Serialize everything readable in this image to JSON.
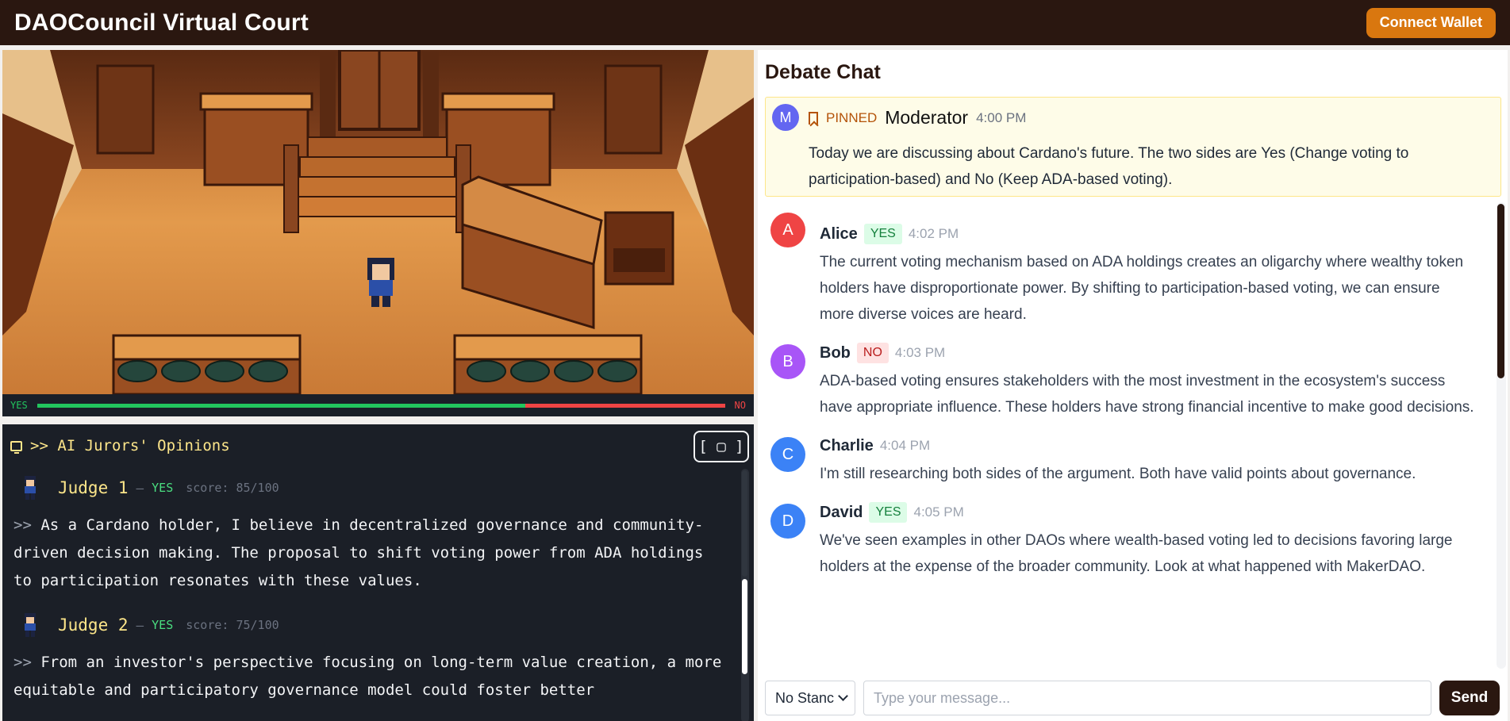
{
  "header": {
    "title": "DAOCouncil Virtual Court",
    "connect_label": "Connect Wallet"
  },
  "scene": {
    "vote_yes_label": "YES",
    "vote_no_label": "NO",
    "yes_fraction": 0.71
  },
  "jurors": {
    "title": ">> AI Jurors' Opinions",
    "expand_label": "[ ▢ ]",
    "items": [
      {
        "name": "Judge 1",
        "dash": "—",
        "vote": "YES",
        "score": "score: 85/100",
        "prompt": ">>",
        "text": "As a Cardano holder, I believe in decentralized governance and community-driven decision making. The proposal to shift voting power from ADA holdings to participation resonates with these values."
      },
      {
        "name": "Judge 2",
        "dash": "—",
        "vote": "YES",
        "score": "score: 75/100",
        "prompt": ">>",
        "text": "From an investor's perspective focusing on long-term value creation, a more equitable and participatory governance model could foster better"
      }
    ]
  },
  "chat": {
    "title": "Debate Chat",
    "pinned": {
      "avatar": "M",
      "label": "PINNED",
      "author": "Moderator",
      "time": "4:00 PM",
      "text": "Today we are discussing about Cardano's future. The two sides are Yes (Change voting to participation-based) and No (Keep ADA-based voting)."
    },
    "messages": [
      {
        "avatar": "A",
        "author": "Alice",
        "stance": "YES",
        "time": "4:02 PM",
        "text": "The current voting mechanism based on ADA holdings creates an oligarchy where wealthy token holders have disproportionate power. By shifting to participation-based voting, we can ensure more diverse voices are heard."
      },
      {
        "avatar": "B",
        "author": "Bob",
        "stance": "NO",
        "time": "4:03 PM",
        "text": "ADA-based voting ensures stakeholders with the most investment in the ecosystem's success have appropriate influence. These holders have strong financial incentive to make good decisions."
      },
      {
        "avatar": "C",
        "author": "Charlie",
        "stance": "",
        "time": "4:04 PM",
        "text": "I'm still researching both sides of the argument. Both have valid points about governance."
      },
      {
        "avatar": "D",
        "author": "David",
        "stance": "YES",
        "time": "4:05 PM",
        "text": "We've seen examples in other DAOs where wealth-based voting led to decisions favoring large holders at the expense of the broader community. Look at what happened with MakerDAO."
      }
    ],
    "stance_select": "No Stanc",
    "input_placeholder": "Type your message...",
    "send_label": "Send"
  },
  "colors": {
    "header_bg": "#2a1710",
    "accent": "#d9770f",
    "yes": "#22c55e",
    "no": "#ef4444",
    "avatar_alice": "#ef4444",
    "avatar_bob": "#a855f7",
    "avatar_charlie": "#3b82f6",
    "avatar_david": "#3b82f6",
    "avatar_moderator": "#6366f1"
  }
}
